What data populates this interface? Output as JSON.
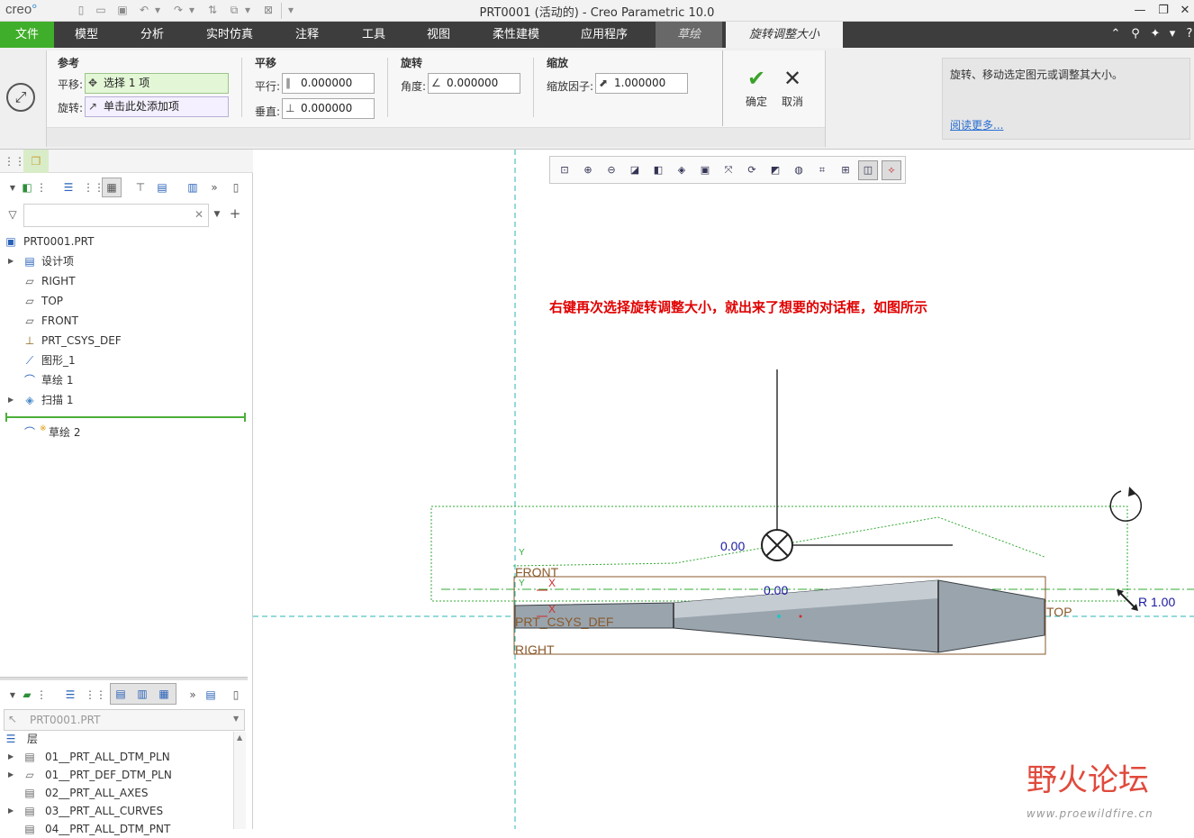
{
  "titlebar": {
    "logo": "creo",
    "logo_mark": "°",
    "title": "PRT0001 (活动的) - Creo Parametric 10.0",
    "controls": [
      "—",
      "❐",
      "✕"
    ]
  },
  "menu": {
    "tabs": [
      "文件",
      "模型",
      "分析",
      "实时仿真",
      "注释",
      "工具",
      "视图",
      "柔性建模",
      "应用程序",
      "草绘",
      "旋转调整大小"
    ],
    "right_icons": [
      "chevron-up-icon",
      "search-icon",
      "settings-icon",
      "graduation-cap-icon",
      "help-icon"
    ]
  },
  "ribbon": {
    "ref_group": "参考",
    "translate_label": "平移:",
    "translate_value": "选择 1 项",
    "rotate_label": "旋转:",
    "rotate_value": "单击此处添加项",
    "move_group": "平移",
    "parallel_label": "平行:",
    "parallel_value": "0.000000",
    "perp_label": "垂直:",
    "perp_value": "0.000000",
    "rotation_group": "旋转",
    "angle_label": "角度:",
    "angle_value": "0.000000",
    "scale_group": "缩放",
    "scale_label": "缩放因子:",
    "scale_value": "1.000000",
    "ok_label": "确定",
    "cancel_label": "取消"
  },
  "help": {
    "text": "旋转、移动选定图元或调整其大小。",
    "link": "阅读更多..."
  },
  "model_tree": {
    "root": "PRT0001.PRT",
    "items": [
      {
        "label": "设计项",
        "icon": "design-items-icon",
        "expandable": true
      },
      {
        "label": "RIGHT",
        "icon": "datum-plane-icon",
        "expandable": false
      },
      {
        "label": "TOP",
        "icon": "datum-plane-icon",
        "expandable": false
      },
      {
        "label": "FRONT",
        "icon": "datum-plane-icon",
        "expandable": false
      },
      {
        "label": "PRT_CSYS_DEF",
        "icon": "csys-icon",
        "expandable": false
      },
      {
        "label": "图形_1",
        "icon": "graph-icon",
        "expandable": false
      },
      {
        "label": "草绘 1",
        "icon": "sketch-icon",
        "expandable": false
      },
      {
        "label": "扫描 1",
        "icon": "sweep-icon",
        "expandable": true
      }
    ],
    "active_item": "草绘 2",
    "active_marker": "※"
  },
  "layers": {
    "selector": "PRT0001.PRT",
    "root": "层",
    "items": [
      "01__PRT_ALL_DTM_PLN",
      "01__PRT_DEF_DTM_PLN",
      "02__PRT_ALL_AXES",
      "03__PRT_ALL_CURVES",
      "04__PRT_ALL_DTM_PNT"
    ]
  },
  "graphics": {
    "annotation": "右键再次选择旋转调整大小，就出来了想要的对话框，如图所示",
    "dim_left": "0.00",
    "dim_center": "0.00",
    "scale_readout": "R 1.00",
    "labels": {
      "front": "FRONT",
      "top": "TOP",
      "right": "RIGHT",
      "csys": "PRT_CSYS_DEF",
      "x1": "X",
      "x2": "X",
      "y1": "Y",
      "y2": "Y"
    }
  },
  "watermark": {
    "text": "野火论坛",
    "url": "www.proewildfire.cn"
  },
  "colors": {
    "file_tab": "#3fae2a",
    "menubar": "#3d3d3d",
    "annotation": "#e00000",
    "datum": "#8a5a2b",
    "sketch_green": "#33aa33",
    "dim_blue": "#1a1aa0"
  }
}
